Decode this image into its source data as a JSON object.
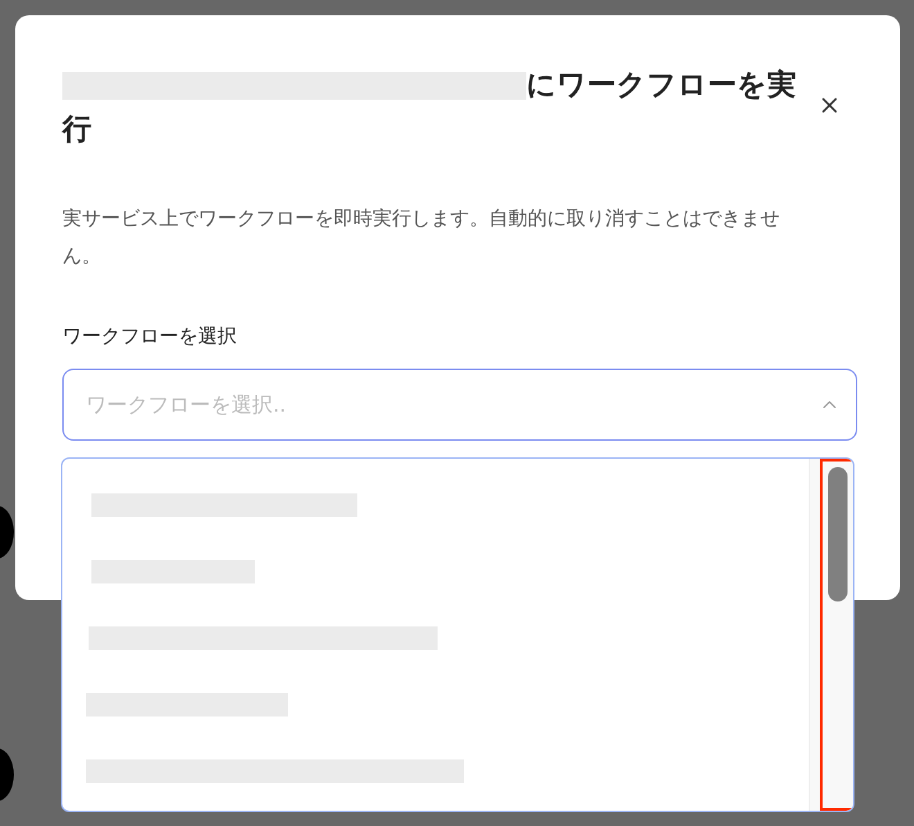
{
  "dialog": {
    "title": {
      "redacted_prefix": true,
      "text": "にワークフローを実行"
    },
    "description": "実サービス上でワークフローを即時実行します。自動的に取り消すことはできません。",
    "field": {
      "label": "ワークフローを選択",
      "placeholder": "ワークフローを選択..",
      "expanded": true
    },
    "options": [
      {
        "kind": "redacted"
      },
      {
        "kind": "redacted"
      },
      {
        "kind": "redacted"
      },
      {
        "kind": "redacted"
      },
      {
        "kind": "redacted"
      }
    ],
    "scrollbar_highlight": {
      "color": "#ff2a00"
    }
  }
}
